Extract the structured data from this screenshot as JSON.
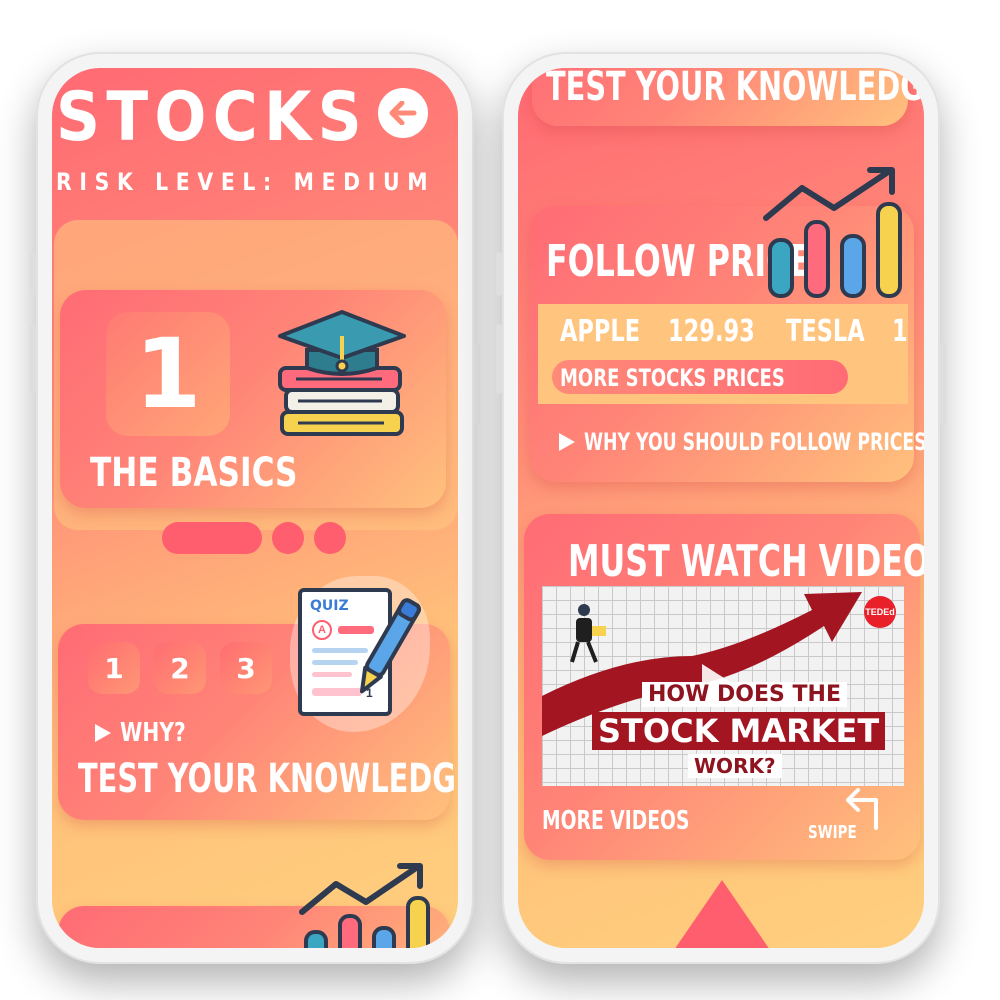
{
  "left_screen": {
    "title": "STOCKS",
    "risk_level": "RISK LEVEL: MEDIUM",
    "back_icon": "arrow-left-icon",
    "lesson_card": {
      "number": "1",
      "title": "THE BASICS",
      "icon": "graduation-cap-books-icon"
    },
    "quiz_card": {
      "steps": [
        "1",
        "2",
        "3"
      ],
      "why_label": "WHY?",
      "title": "TEST YOUR KNOWLEDGE",
      "quiz_badge": "QUIZ",
      "quiz_answer": "A",
      "quiz_counter": "1",
      "icon": "quiz-sheet-icon"
    },
    "bottom_card_icon": "growth-chart-icon"
  },
  "right_screen": {
    "top_card_title": "TEST YOUR KNOWLEDGE",
    "follow_card": {
      "title": "FOLLOW PRICE",
      "ticker": [
        {
          "symbol": "APPLE",
          "price": "129.93"
        },
        {
          "symbol": "TESLA",
          "price": "1"
        }
      ],
      "more_prices_label": "MORE STOCKS PRICES",
      "why_label": "WHY YOU SHOULD FOLLOW PRICES?",
      "icon": "growth-chart-icon"
    },
    "videos_card": {
      "title": "MUST WATCH VIDEOS",
      "video": {
        "badge": "TEDEd",
        "line1": "HOW DOES THE",
        "line2": "STOCK MARKET",
        "line3": "WORK?"
      },
      "more_videos_label": "MORE VIDEOS",
      "swipe_label": "SWIPE",
      "swipe_icon": "swipe-arrow-icon"
    },
    "bottom_nav_icon": "triangle-up-icon"
  },
  "colors": {
    "accent": "#ff5e6e",
    "warm": "#ffc27a",
    "video_red": "#a31621"
  }
}
